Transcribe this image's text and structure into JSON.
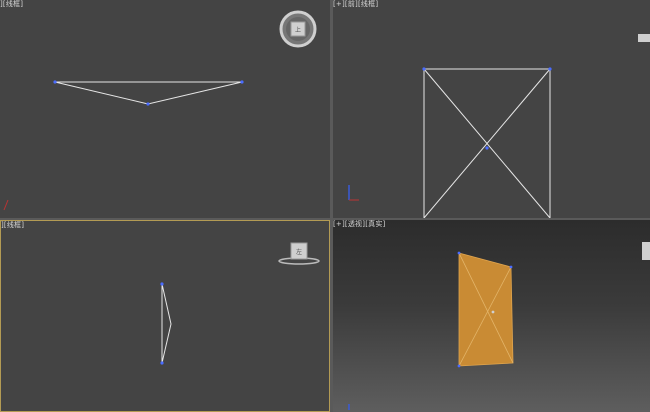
{
  "viewports": {
    "top": {
      "label": "][线框]"
    },
    "front": {
      "label": "[+][前][线框]"
    },
    "left": {
      "label": "][线框]"
    },
    "perspective": {
      "label": "[+][透视][真实]"
    }
  },
  "colors": {
    "viewport_bg": "#444444",
    "wire": "#e6e6e6",
    "vertex": "#4a6cff",
    "active_border": "#b39b54",
    "shaded_fill": "#c98b34"
  },
  "icons": [
    "viewcube-top-icon",
    "viewcube-front-icon",
    "viewcube-left-icon",
    "viewcube-perspective-icon",
    "axis-gizmo-icon"
  ]
}
